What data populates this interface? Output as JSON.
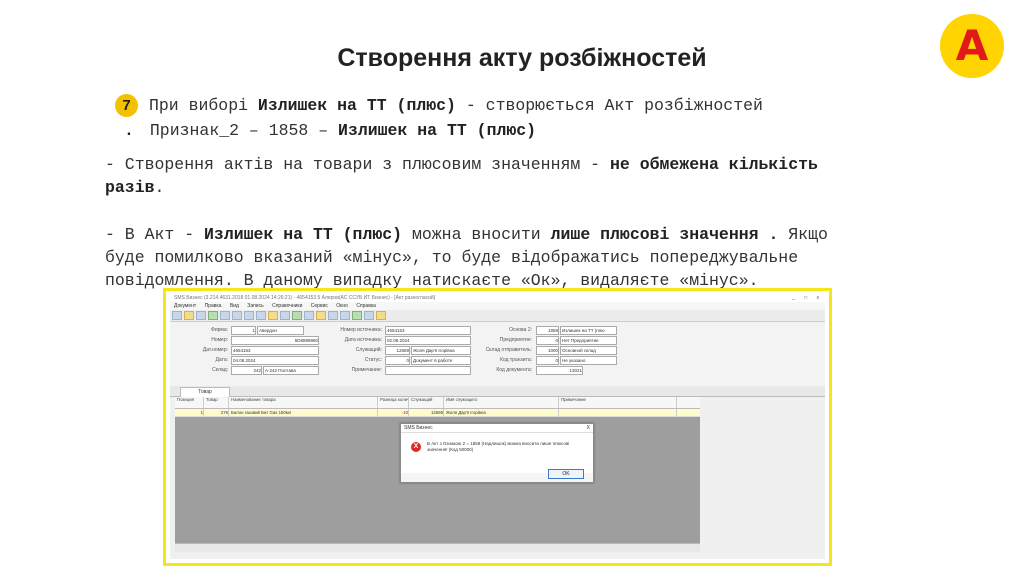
{
  "slide": {
    "title": "Створення акту розбіжностей",
    "logo_letter": "A",
    "step_number": "7",
    "p1_line1_a": "При виборі ",
    "p1_line1_b": "Излишек на ТТ (плюс)",
    "p1_line1_c": " - створюється Акт розбіжностей",
    "p1_line2_dot": ".",
    "p1_line2_a": "Признак_2 – 1858 – ",
    "p1_line2_b": "Излишек на ТТ (плюс)",
    "p2_line1_a": "- Створення актів на товари з плюсовим значенням - ",
    "p2_line1_b": "не обмежена кількість",
    "p2_line2_b": "разів",
    "p2_line2_c": ".",
    "p3_line1_a": "- В Акт - ",
    "p3_line1_b": "Излишек на ТТ (плюс)",
    "p3_line1_c": " можна вносити ",
    "p3_line1_d": "лише плюсові значення .",
    "p3_line1_e": " Якщо",
    "p3_line2": "буде помилково вказаний «мінус», то буде відображатись попереджувальне",
    "p3_line3": "повідомлення. В даному випадку натискаєте «Ок», видаляєте «мінус»."
  },
  "app": {
    "window_title": "SMS Бизнес (3.214.4631.2018 01.08.2024 14:26:21) - 4654153 5 Алеров(АС ССУБ ИТ Бизнес) - [Акт разногласий]",
    "window_buttons": "_ □ x",
    "menu": [
      "Документ",
      "Правка",
      "Вид",
      "Запись",
      "Справочники",
      "Сервис",
      "Окно",
      "Справка"
    ],
    "form": {
      "firma_label": "Фирма:",
      "firma_code": "1",
      "firma_name": "Авердон",
      "nomer_label": "Номер:",
      "nomer_value": "5D8898880",
      "dat_nomer_label": "Дат.номер:",
      "dat_nomer_value": "4654153",
      "data_label": "Дата:",
      "data_value": "04.08.2024",
      "sklad_label": "Склад:",
      "sklad_code": "242",
      "sklad_name": "А-242 Полтава",
      "nomer_ist_label": "Номер источника:",
      "nomer_ist_value": "4654153",
      "data_ist_label": "Дата источника:",
      "data_ist_value": "02.08.2024",
      "sluzh_label": "Служащий:",
      "sluzh_code": "12669",
      "sluzh_name": "Жоля Дар'я Ігорівна",
      "status_label": "Статус:",
      "status_code": "0",
      "status_name": "Документ в работе",
      "primech_label": "Примечание:",
      "osnova_label": "Основа 2:",
      "osnova_code": "1858",
      "osnova_name": "Излишек на ТТ (плю",
      "predpr_label": "Предприятие:",
      "predpr_code": "0",
      "predpr_name": "Нет Предприятие",
      "sklad_otpr_label": "Склад отправитель:",
      "sklad_otpr_code": "1000",
      "sklad_otpr_name": "Основной склад",
      "kod_trans_label": "Код транзита:",
      "kod_trans_code": "0",
      "kod_trans_name": "Не указано",
      "kod_doc_label": "Код документа:",
      "kod_doc_value": "13021"
    },
    "tab_label": "Товар",
    "grid": {
      "headers": [
        "Позиция",
        "Товар",
        "Наименование товара",
        "Разница количества",
        "Служащий",
        "Имя служащего",
        "Примечание"
      ],
      "row": [
        "1",
        "276",
        "Балон газовий Бит Gas 150мл",
        "-10",
        "12669",
        "Жоля Дар'я Ігорівна",
        ""
      ]
    },
    "dialog": {
      "title": "SMS Бизнес",
      "close": "X",
      "icon": "X",
      "message": "В Акт з Ознакою 2 = 1858 (Надлишок) можна вносити лише плюсові значення! (Код 50000)",
      "ok_label": "OK"
    }
  }
}
